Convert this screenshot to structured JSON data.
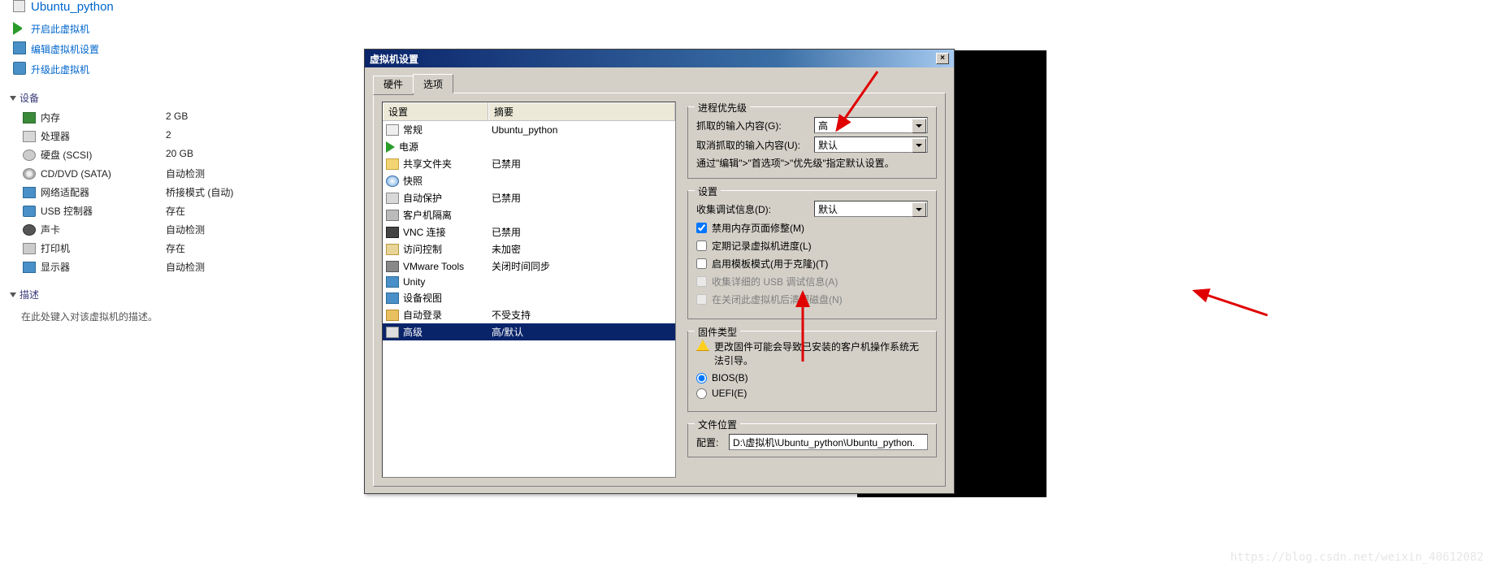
{
  "vm_name": "Ubuntu_python",
  "actions": {
    "power_on": "开启此虚拟机",
    "edit_settings": "编辑虚拟机设置",
    "upgrade": "升级此虚拟机"
  },
  "sections": {
    "devices": "设备",
    "description": "描述"
  },
  "hardware": [
    {
      "name": "内存",
      "value": "2 GB",
      "icon": "ic-mem",
      "dn": "hw-memory"
    },
    {
      "name": "处理器",
      "value": "2",
      "icon": "ic-cpu",
      "dn": "hw-cpu"
    },
    {
      "name": "硬盘 (SCSI)",
      "value": "20 GB",
      "icon": "ic-disk",
      "dn": "hw-disk"
    },
    {
      "name": "CD/DVD (SATA)",
      "value": "自动检测",
      "icon": "ic-cd",
      "dn": "hw-cd"
    },
    {
      "name": "网络适配器",
      "value": "桥接模式 (自动)",
      "icon": "ic-net",
      "dn": "hw-net"
    },
    {
      "name": "USB 控制器",
      "value": "存在",
      "icon": "ic-usb",
      "dn": "hw-usb"
    },
    {
      "name": "声卡",
      "value": "自动检测",
      "icon": "ic-sound",
      "dn": "hw-sound"
    },
    {
      "name": "打印机",
      "value": "存在",
      "icon": "ic-print",
      "dn": "hw-printer"
    },
    {
      "name": "显示器",
      "value": "自动检测",
      "icon": "ic-disp",
      "dn": "hw-display"
    }
  ],
  "desc_hint": "在此处键入对该虚拟机的描述。",
  "dialog": {
    "title": "虚拟机设置",
    "tabs": {
      "hardware": "硬件",
      "options": "选项"
    },
    "list_headers": {
      "setting": "设置",
      "summary": "摘要"
    },
    "rows": [
      {
        "name": "常规",
        "summary": "Ubuntu_python",
        "icon": "fic-gen",
        "dn": "opt-general"
      },
      {
        "name": "电源",
        "summary": "",
        "icon": "fic-pwr",
        "dn": "opt-power"
      },
      {
        "name": "共享文件夹",
        "summary": "已禁用",
        "icon": "fic-fold",
        "dn": "opt-shared"
      },
      {
        "name": "快照",
        "summary": "",
        "icon": "fic-snap",
        "dn": "opt-snapshot"
      },
      {
        "name": "自动保护",
        "summary": "已禁用",
        "icon": "fic-auto",
        "dn": "opt-autoprotect"
      },
      {
        "name": "客户机隔离",
        "summary": "",
        "icon": "fic-guest",
        "dn": "opt-guest"
      },
      {
        "name": "VNC 连接",
        "summary": "已禁用",
        "icon": "fic-vnc",
        "dn": "opt-vnc"
      },
      {
        "name": "访问控制",
        "summary": "未加密",
        "icon": "fic-access",
        "dn": "opt-access"
      },
      {
        "name": "VMware Tools",
        "summary": "关闭时间同步",
        "icon": "fic-tools",
        "dn": "opt-tools"
      },
      {
        "name": "Unity",
        "summary": "",
        "icon": "fic-unity",
        "dn": "opt-unity"
      },
      {
        "name": "设备视图",
        "summary": "",
        "icon": "fic-view",
        "dn": "opt-device-view"
      },
      {
        "name": "自动登录",
        "summary": "不受支持",
        "icon": "fic-login",
        "dn": "opt-autologin"
      },
      {
        "name": "高级",
        "summary": "高/默认",
        "icon": "fic-adv",
        "dn": "opt-advanced",
        "sel": true
      }
    ],
    "priority": {
      "legend": "进程优先级",
      "grab_label": "抓取的输入内容(G):",
      "grab_value": "高",
      "ungrab_label": "取消抓取的输入内容(U):",
      "ungrab_value": "默认",
      "hint": "通过\"编辑\">\"首选项\">\"优先级\"指定默认设置。"
    },
    "settings_grp": {
      "legend": "设置",
      "debug_label": "收集调试信息(D):",
      "debug_value": "默认",
      "check_mem": "禁用内存页面修整(M)",
      "check_log": "定期记录虚拟机进度(L)",
      "check_template": "启用模板模式(用于克隆)(T)",
      "check_usb": "收集详细的 USB 调试信息(A)",
      "check_clean": "在关闭此虚拟机后清理磁盘(N)"
    },
    "firmware": {
      "legend": "固件类型",
      "warning": "更改固件可能会导致已安装的客户机操作系统无法引导。",
      "bios": "BIOS(B)",
      "uefi": "UEFI(E)"
    },
    "filepos": {
      "legend": "文件位置",
      "cfg_label": "配置:",
      "cfg_value": "D:\\虚拟机\\Ubuntu_python\\Ubuntu_python."
    }
  },
  "watermark": "https://blog.csdn.net/weixin_40612082"
}
